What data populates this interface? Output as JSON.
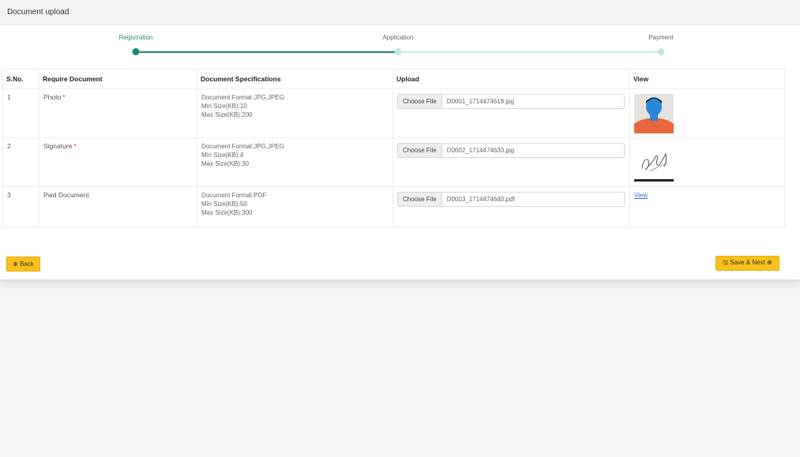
{
  "header": {
    "title": "Document upload"
  },
  "stepper": {
    "steps": [
      {
        "label": "Registration",
        "state": "done"
      },
      {
        "label": "Application",
        "state": "current"
      },
      {
        "label": "Payment",
        "state": "pending"
      }
    ],
    "colors": {
      "done": "#1b8a77",
      "pending": "#bfeae3"
    }
  },
  "table": {
    "headers": [
      "S.No.",
      "Require Document",
      "Document Specifications",
      "Upload",
      "View"
    ],
    "rows": [
      {
        "sno": "1",
        "document": "Photo",
        "required": "*",
        "spec": [
          "Document Format:JPG,JPEG",
          "Min Size(KB):10",
          "Max Size(KB):200"
        ],
        "choose_label": "Choose File",
        "file_name": "D0001_1714474618.jpg",
        "view": "photo-thumbnail"
      },
      {
        "sno": "2",
        "document": "Signature",
        "required": "*",
        "spec": [
          "Document Format:JPG,JPEG",
          "Min Size(KB):4",
          "Max Size(KB):30"
        ],
        "choose_label": "Choose File",
        "file_name": "D0002_1714474633.jpg",
        "view": "signature-thumbnail"
      },
      {
        "sno": "3",
        "document": "Pwd Document",
        "required": "",
        "spec": [
          "Document Format:PDF",
          "Min Size(KB):50",
          "Max Size(KB):300"
        ],
        "choose_label": "Choose File",
        "file_name": "D0003_1714474640.pdf",
        "view_link": "View"
      }
    ]
  },
  "footer": {
    "back_label": "⊕ Back",
    "save_label": "🖫 Save & Next ⊕"
  }
}
